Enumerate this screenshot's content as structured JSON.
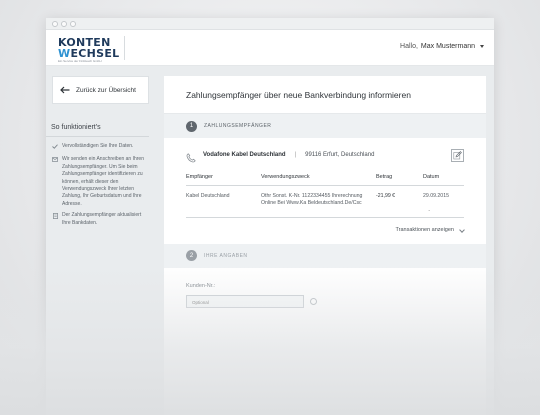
{
  "window": {
    "controls": [
      "close",
      "minimize",
      "maximize"
    ]
  },
  "header": {
    "logo": {
      "line1": "KONTEN",
      "line2_first": "W",
      "line2_rest": "ECHSEL",
      "tagline": "Ein Service der FinReach GmbH"
    },
    "greeting": "Hallo,",
    "user_name": "Max Mustermann"
  },
  "sidebar": {
    "back_label": "Zurück zur Übersicht",
    "how_title": "So funktioniert's",
    "steps": [
      {
        "icon": "check-icon",
        "text": "Vervollständigen Sie Ihre Daten."
      },
      {
        "icon": "mail-icon",
        "text": "Wir senden ein Anschreiben an Ihren Zahlungsempfänger. Um Sie beim Zahlungsempfänger identifizieren zu können, erhält dieser den Verwendungszweck Ihrer letzten Zahlung, Ihr Geburtsdatum und Ihre Adresse."
      },
      {
        "icon": "document-icon",
        "text": "Der Zahlungsempfänger aktualisiert Ihre Bankdaten."
      }
    ]
  },
  "main": {
    "title": "Zahlungsempfänger über neue Bankverbindung informieren",
    "section1": {
      "number": "1",
      "label": "ZAHLUNGSEMPFÄNGER",
      "payee_name": "Vodafone Kabel Deutschland",
      "payee_separator": "|",
      "payee_address": "99116 Erfurt, Deutschland",
      "table": {
        "headers": [
          "Empfänger",
          "Verwendungszweck",
          "Betrag",
          "Datum"
        ],
        "rows": [
          {
            "recipient": "Kabel Deutschland",
            "purpose": "Othr Sonst. K-Nr. 1122334455 Ihrerechnung Online Bei Www.Ka Beldeutschland.De/Csc",
            "amount": "-21,99 €",
            "date": "29.09.2015"
          }
        ],
        "row_marker": "-"
      },
      "transactions_link": "Transaktionen anzeigen"
    },
    "section2": {
      "number": "2",
      "label": "IHRE ANGABEN",
      "customer_label": "Kunden-Nr.:",
      "customer_placeholder": "Optional"
    }
  }
}
